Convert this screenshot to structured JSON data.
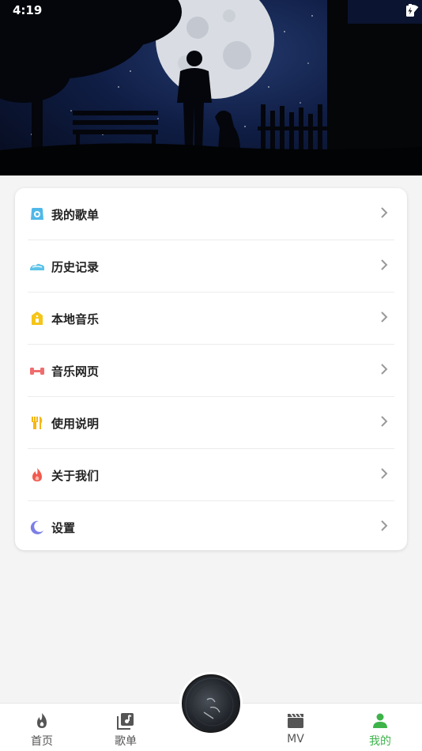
{
  "status_bar": {
    "time": "4:19",
    "icons": [
      "wifi-icon",
      "battery-icon"
    ]
  },
  "banner": {
    "image": "night-scene-moon-man-dog-bench"
  },
  "menu": {
    "items": [
      {
        "label": "我的歌单",
        "icon": "playlist-icon",
        "color": "#4fb8e8"
      },
      {
        "label": "历史记录",
        "icon": "history-icon",
        "color": "#5ec3e8"
      },
      {
        "label": "本地音乐",
        "icon": "local-music-icon",
        "color": "#f5c518"
      },
      {
        "label": "音乐网页",
        "icon": "music-web-icon",
        "color": "#f06d6d"
      },
      {
        "label": "使用说明",
        "icon": "instructions-icon",
        "color": "#f5b614"
      },
      {
        "label": "关于我们",
        "icon": "about-us-icon",
        "color": "#f05a4f"
      },
      {
        "label": "设置",
        "icon": "settings-icon",
        "color": "#7b7fe6"
      }
    ]
  },
  "bottom_nav": {
    "items": [
      {
        "label": "首页",
        "icon": "flame-icon"
      },
      {
        "label": "歌单",
        "icon": "playlist-icon"
      },
      {
        "label": "MV",
        "icon": "clapperboard-icon"
      },
      {
        "label": "我的",
        "icon": "person-icon",
        "active": true
      }
    ],
    "active_color": "#3db34a"
  },
  "now_playing": {
    "icon": "album-disc-icon"
  }
}
